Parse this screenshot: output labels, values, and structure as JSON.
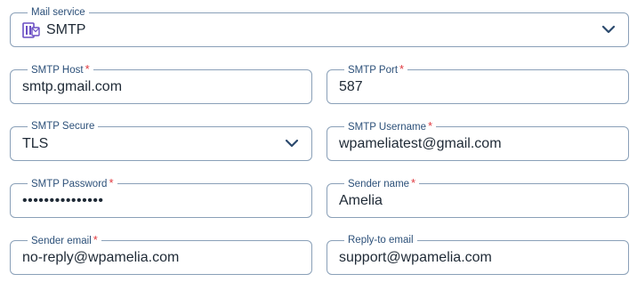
{
  "mail_service": {
    "label": "Mail service",
    "value": "SMTP",
    "icon": "smtp-server-icon"
  },
  "smtp_host": {
    "label": "SMTP Host",
    "required_mark": "*",
    "value": "smtp.gmail.com"
  },
  "smtp_port": {
    "label": "SMTP Port",
    "required_mark": "*",
    "value": "587"
  },
  "smtp_secure": {
    "label": "SMTP Secure",
    "value": "TLS"
  },
  "smtp_username": {
    "label": "SMTP Username",
    "required_mark": "*",
    "value": "wpameliatest@gmail.com"
  },
  "smtp_password": {
    "label": "SMTP Password",
    "required_mark": "*",
    "value": "•••••••••••••••"
  },
  "sender_name": {
    "label": "Sender name",
    "required_mark": "*",
    "value": "Amelia"
  },
  "sender_email": {
    "label": "Sender email",
    "required_mark": "*",
    "value": "no-reply@wpamelia.com"
  },
  "reply_to_email": {
    "label": "Reply-to email",
    "value": "support@wpamelia.com"
  },
  "colors": {
    "border": "#8aa0b8",
    "label": "#2c5079",
    "required": "#e0383e",
    "text": "#1f2a36",
    "icon": "#6b4fc4"
  }
}
